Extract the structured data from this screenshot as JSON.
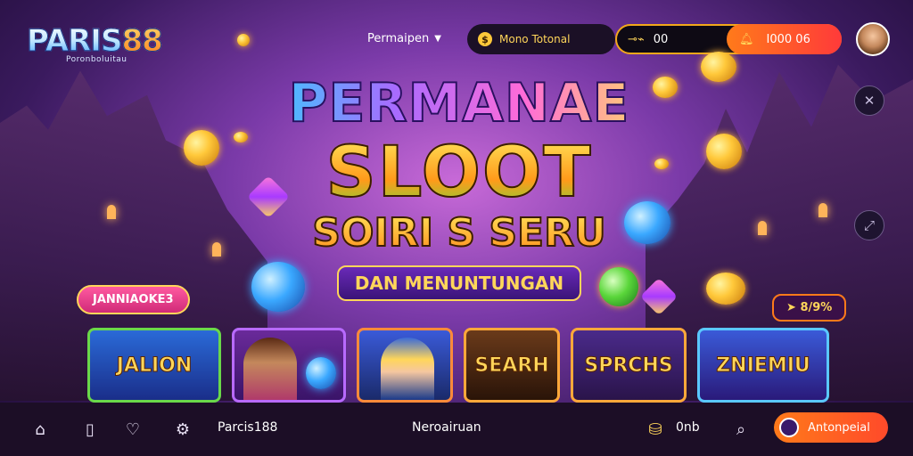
{
  "brand": {
    "logo_part1": "PARIS",
    "logo_part2": "88",
    "logo_sub": "Poronboluitau"
  },
  "header": {
    "menu_label": "Permaipen",
    "pill_text": "Mono Totonal",
    "balance_text": "00",
    "cta_text": "I000 06"
  },
  "hero": {
    "title": "PERMANAE",
    "big": "SLOOT",
    "sub": "SOIRI S SERU",
    "banner": "DAN MENUNTUNGAN"
  },
  "tags": {
    "left": "JANNIAOKE3",
    "right": "8/9%"
  },
  "tiles": [
    {
      "label": "JALION"
    },
    {
      "label": ""
    },
    {
      "label": ""
    },
    {
      "label": "SEARH"
    },
    {
      "label": "SPRCHS"
    },
    {
      "label": "ZNIEMIU"
    }
  ],
  "bottom_bar": {
    "brand": "Parcis188",
    "center": "Neroairuan",
    "count": "0nb",
    "cta": "Antonpeial"
  },
  "colors": {
    "accent": "#ff7a1a",
    "bar_bg": "#1c0e26",
    "gold": "#ffd65a"
  },
  "icons": [
    "home-icon",
    "card-icon",
    "heart-icon",
    "gear-icon",
    "bag-icon",
    "search-icon"
  ]
}
